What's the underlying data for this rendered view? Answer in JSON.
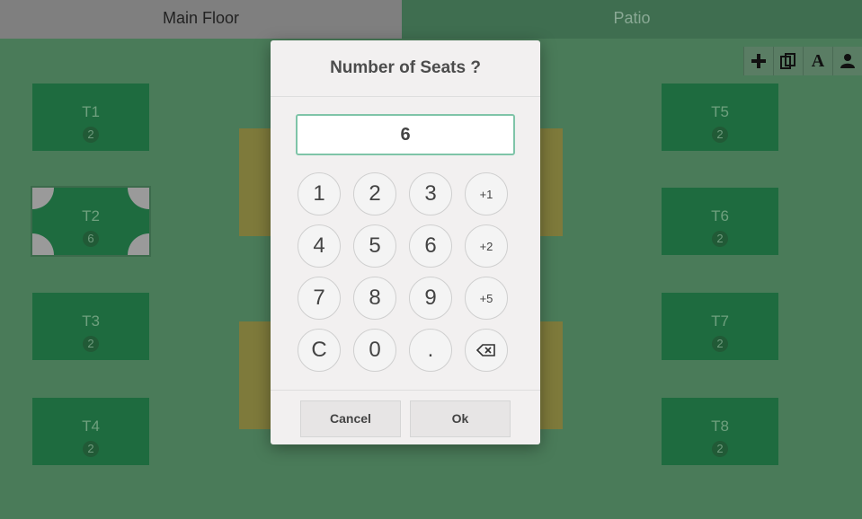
{
  "floors": {
    "main": "Main Floor",
    "patio": "Patio"
  },
  "toolbar": {
    "icons": [
      "plus-icon",
      "copy-icon",
      "text-icon",
      "user-icon"
    ],
    "text_glyph": "A"
  },
  "tables": [
    {
      "name": "T1",
      "seats": "2"
    },
    {
      "name": "T2",
      "seats": "6"
    },
    {
      "name": "T3",
      "seats": "2"
    },
    {
      "name": "T4",
      "seats": "2"
    },
    {
      "name": "T5",
      "seats": "2"
    },
    {
      "name": "T6",
      "seats": "2"
    },
    {
      "name": "T7",
      "seats": "2"
    },
    {
      "name": "T8",
      "seats": "2"
    }
  ],
  "dialog": {
    "title": "Number of Seats ?",
    "value": "6",
    "keys": [
      "1",
      "2",
      "3",
      "+1",
      "4",
      "5",
      "6",
      "+2",
      "7",
      "8",
      "9",
      "+5",
      "C",
      "0",
      "."
    ],
    "cancel": "Cancel",
    "ok": "Ok"
  },
  "colors": {
    "background": "#4a7b59",
    "table": "#1e6b3f",
    "accent": "#7fc4a8"
  }
}
